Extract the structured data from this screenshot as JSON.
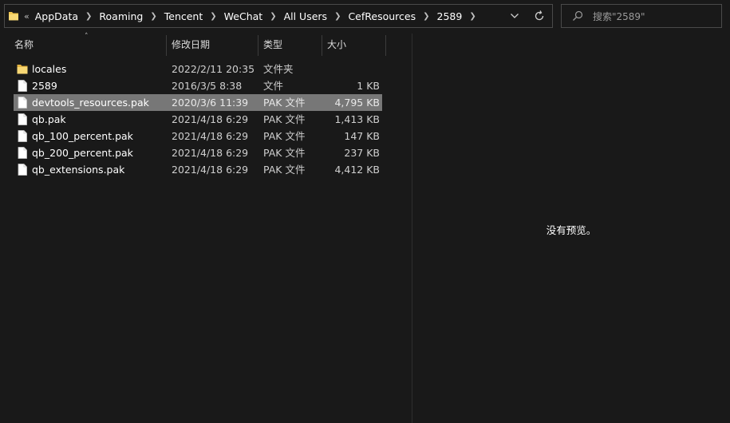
{
  "address_bar": {
    "overflow": "«",
    "crumbs": [
      "AppData",
      "Roaming",
      "Tencent",
      "WeChat",
      "All Users",
      "CefResources",
      "2589"
    ]
  },
  "search": {
    "placeholder": "搜索\"2589\""
  },
  "columns": {
    "name": "名称",
    "date": "修改日期",
    "type": "类型",
    "size": "大小"
  },
  "files": [
    {
      "name": "locales",
      "date": "2022/2/11 20:35",
      "type": "文件夹",
      "size": "",
      "icon": "folder-icon",
      "selected": false
    },
    {
      "name": "2589",
      "date": "2016/3/5 8:38",
      "type": "文件",
      "size": "1 KB",
      "icon": "file-icon",
      "selected": false
    },
    {
      "name": "devtools_resources.pak",
      "date": "2020/3/6 11:39",
      "type": "PAK 文件",
      "size": "4,795 KB",
      "icon": "file-icon",
      "selected": true
    },
    {
      "name": "qb.pak",
      "date": "2021/4/18 6:29",
      "type": "PAK 文件",
      "size": "1,413 KB",
      "icon": "file-icon",
      "selected": false
    },
    {
      "name": "qb_100_percent.pak",
      "date": "2021/4/18 6:29",
      "type": "PAK 文件",
      "size": "147 KB",
      "icon": "file-icon",
      "selected": false
    },
    {
      "name": "qb_200_percent.pak",
      "date": "2021/4/18 6:29",
      "type": "PAK 文件",
      "size": "237 KB",
      "icon": "file-icon",
      "selected": false
    },
    {
      "name": "qb_extensions.pak",
      "date": "2021/4/18 6:29",
      "type": "PAK 文件",
      "size": "4,412 KB",
      "icon": "file-icon",
      "selected": false
    }
  ],
  "preview": {
    "empty_text": "没有预览。"
  },
  "colors": {
    "background": "#191919",
    "selection": "#777777",
    "folder": "#f0c650",
    "border": "#4a4a4a"
  }
}
